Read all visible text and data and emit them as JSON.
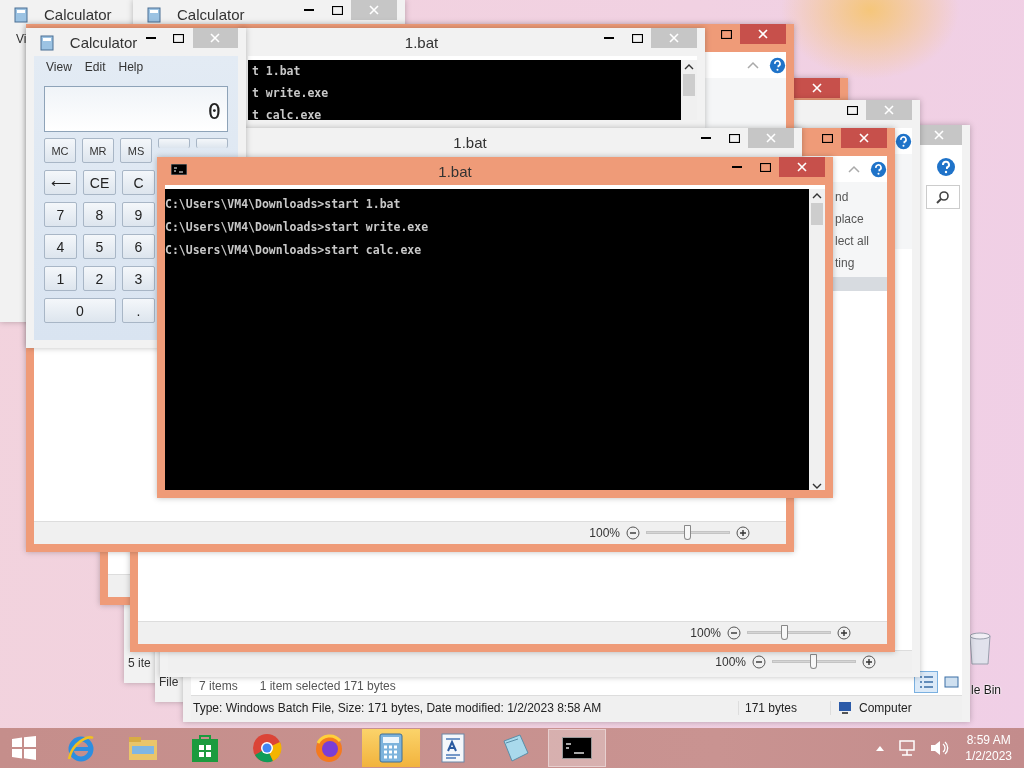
{
  "explorer_back_windows": [
    {
      "status": "5 ite"
    },
    {
      "status": "File"
    }
  ],
  "explorer": {
    "status": {
      "items": "7 items",
      "selection": "1 item selected  171 bytes"
    },
    "details": {
      "info": "Type: Windows Batch File, Size: 171 bytes, Date modified: 1/2/2023 8:58 AM",
      "size": "171 bytes",
      "location": "Computer"
    }
  },
  "calculator_back_windows": [
    {
      "title": "Calculator",
      "menu": [
        "Vi"
      ]
    },
    {
      "title": "Calculator"
    }
  ],
  "wordpad_windows": [
    {
      "active": false
    },
    {
      "active": false,
      "zoom": {
        "reading": "100%",
        "level": 0.5
      }
    },
    {
      "active": false,
      "zoom": {
        "reading": "100%",
        "level": 0.45
      },
      "ribbon_labels": [
        "nd",
        "place",
        "lect all",
        "ting"
      ]
    },
    {
      "active": false,
      "zoom": {
        "reading": "100%",
        "level": 0.5
      }
    }
  ],
  "console_windows": [
    {
      "title": "1.bat",
      "active": false,
      "lines": [
        "t 1.bat",
        "t write.exe",
        "t calc.exe"
      ]
    },
    {
      "title": "1.bat",
      "active": false
    }
  ],
  "calculator": {
    "title": "Calculator",
    "menu": [
      "View",
      "Edit",
      "Help"
    ],
    "display": "0",
    "keys": [
      [
        "MC",
        "MR",
        "MS"
      ],
      [
        "⟵",
        "CE",
        "C"
      ],
      [
        "7",
        "8",
        "9"
      ],
      [
        "4",
        "5",
        "6"
      ],
      [
        "1",
        "2",
        "3"
      ],
      [
        "0",
        "."
      ]
    ]
  },
  "console": {
    "title": "1.bat",
    "active": true,
    "lines": [
      "C:\\Users\\VM4\\Downloads>start 1.bat",
      "C:\\Users\\VM4\\Downloads>start write.exe",
      "C:\\Users\\VM4\\Downloads>start calc.exe"
    ]
  },
  "desktop": {
    "recycle_bin": "le Bin"
  },
  "taskbar": {
    "apps": [
      {
        "kind": "ie",
        "selected": false,
        "attention": false
      },
      {
        "kind": "explorer",
        "selected": false,
        "attention": false
      },
      {
        "kind": "store",
        "selected": false,
        "attention": false
      },
      {
        "kind": "chrome",
        "selected": false,
        "attention": false
      },
      {
        "kind": "firefox",
        "selected": false,
        "attention": false
      },
      {
        "kind": "calculator",
        "selected": false,
        "attention": true
      },
      {
        "kind": "wordpad",
        "selected": false,
        "attention": false
      },
      {
        "kind": "notepad",
        "selected": false,
        "attention": false
      },
      {
        "kind": "console",
        "selected": true,
        "attention": false
      }
    ],
    "clock": {
      "time": "8:59 AM",
      "date": "1/2/2023"
    }
  }
}
